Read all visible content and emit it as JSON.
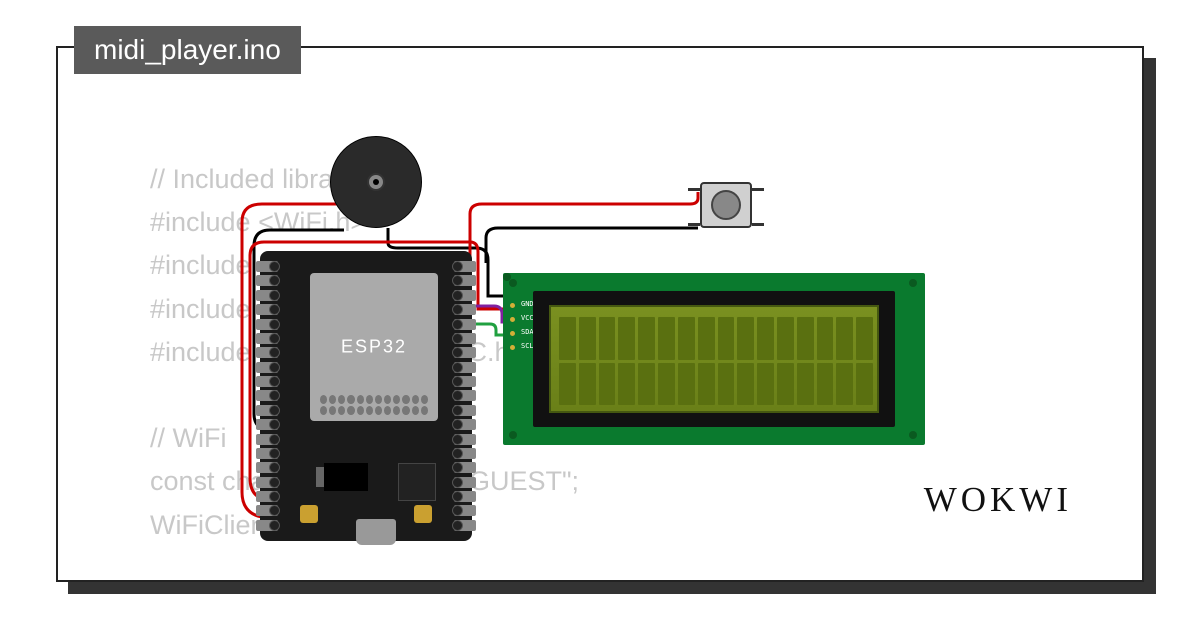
{
  "filename": "midi_player.ino",
  "code_lines": "// Included libraries\n#include <WiFi.h>\n#include <Wire.h>\n#include <PubSubClient.h>\n#include <LiquidCrystal_I2C.h>\n\n// WiFi\nconst char* ssid = \"Wokwi-GUEST\";\nWiFiClient wifiClient;\n",
  "brand": "WOKWI",
  "mcu_label": "ESP32",
  "lcd_pins": [
    "GND",
    "VCC",
    "SDA",
    "SCL"
  ],
  "components": {
    "microcontroller": "ESP32 DevKit",
    "display": "16x2 I2C LCD",
    "buzzer": "Piezo buzzer",
    "button": "Tactile push button"
  },
  "wire_colors": {
    "power": "#cc0000",
    "ground": "#000000",
    "sda": "#8020a0",
    "scl": "#20a040"
  }
}
